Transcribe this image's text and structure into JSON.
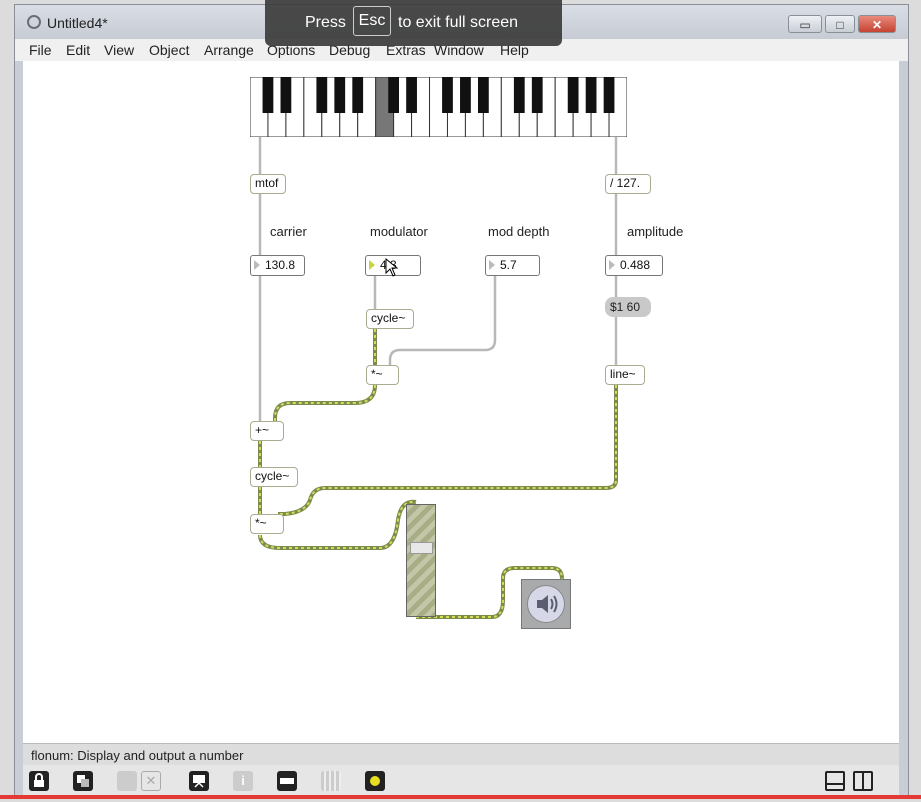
{
  "window": {
    "title": "Untitled4*",
    "buttons": {
      "minimize": "▭",
      "maximize": "□",
      "close": "✕"
    }
  },
  "fullscreen_notice": {
    "press": "Press",
    "key": "Esc",
    "rest": "to exit full screen"
  },
  "menu": [
    "File",
    "Edit",
    "View",
    "Object",
    "Arrange",
    "Options",
    "Debug",
    "Extras",
    "Window",
    "Help"
  ],
  "patch": {
    "objects": {
      "mtof": "mtof",
      "div127": "/ 127.",
      "cycle_mod": "cycle~",
      "mult_depth": "*~",
      "line": "line~",
      "add": "+~",
      "cycle_carrier": "cycle~",
      "mult_amp": "*~"
    },
    "labels": {
      "carrier": "carrier",
      "modulator": "modulator",
      "mod_depth": "mod depth",
      "amplitude": "amplitude"
    },
    "numbers": {
      "carrier": "130.8",
      "modulator": "4.3",
      "mod_depth": "5.7",
      "amplitude": "0.488"
    },
    "message": "$1 60",
    "gain_slider_level": 0.62,
    "keyboard_highlight_key_index": 7
  },
  "status": "flonum: Display and output a number",
  "toolbar_icons": [
    "lock-icon",
    "new-view-icon",
    "grid-snap-icon",
    "clear-icon",
    "presentation-icon",
    "info-icon",
    "object-icon",
    "grid-icon",
    "audio-icon",
    "left-panel-icon",
    "right-panel-icon"
  ],
  "colors": {
    "audio_patch_cord": "#7a8c4c",
    "control_cord": "#b0b0b0",
    "object_border": "#a7ad90"
  }
}
